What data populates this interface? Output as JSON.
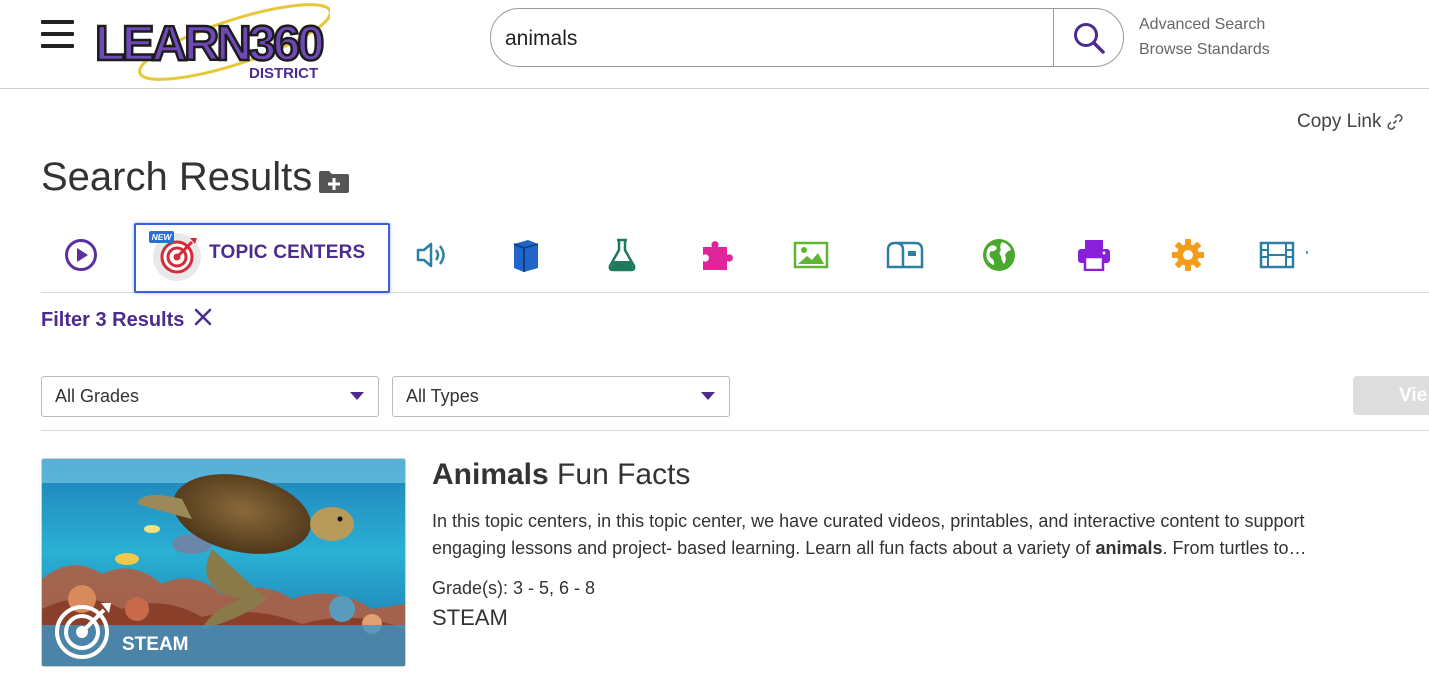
{
  "header": {
    "logo_text": "LEARN360",
    "logo_subtext": "DISTRICT",
    "search_value": "animals",
    "links": [
      "Advanced Search",
      "Browse Standards"
    ]
  },
  "toolbar": {
    "copy_link": "Copy Link"
  },
  "page_title": "Search Results",
  "tabs": {
    "topic_centers": {
      "label": "TOPIC CENTERS",
      "badge": "NEW"
    },
    "icons": [
      "play-circle-icon",
      "audio-icon",
      "book-icon",
      "flask-icon",
      "puzzle-icon",
      "image-icon",
      "mailbox-icon",
      "globe-icon",
      "printer-icon",
      "gear-icon",
      "film-icon"
    ]
  },
  "filter": {
    "label": "Filter 3 Results"
  },
  "dropdowns": {
    "grades": "All Grades",
    "types": "All Types"
  },
  "view_button": "Vie",
  "result": {
    "title_bold": "Animals",
    "title_rest": " Fun Facts",
    "desc_pre": "In this topic centers, in this topic center, we have curated videos, printables, and interactive content to support engaging lessons and project- based learning. Learn all fun facts about a variety of ",
    "desc_bold": "animals",
    "desc_post": ". From turtles to…",
    "grades": "Grade(s): 3 - 5, 6 - 8",
    "category": "STEAM",
    "thumb_label": "STEAM"
  },
  "colors": {
    "brand_purple": "#4b2c8c",
    "focus_blue": "#3c5fd8"
  }
}
